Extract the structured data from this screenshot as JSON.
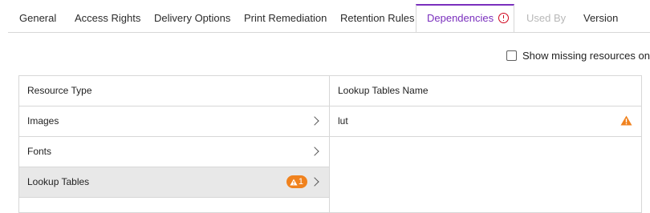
{
  "tabs": [
    {
      "label": "General",
      "state": "normal"
    },
    {
      "label": "Access Rights",
      "state": "normal"
    },
    {
      "label": "Delivery Options",
      "state": "normal"
    },
    {
      "label": "Print Remediation",
      "state": "normal"
    },
    {
      "label": "Retention Rules",
      "state": "normal"
    },
    {
      "label": "Dependencies",
      "state": "active",
      "icon": "alert-circle-icon"
    },
    {
      "label": "Used By",
      "state": "disabled"
    },
    {
      "label": "Version",
      "state": "normal"
    }
  ],
  "filter": {
    "label": "Show missing resources only",
    "checked": false
  },
  "left_panel": {
    "header": "Resource Type",
    "rows": [
      {
        "label": "Images",
        "selected": false,
        "badge": null
      },
      {
        "label": "Fonts",
        "selected": false,
        "badge": null
      },
      {
        "label": "Lookup Tables",
        "selected": true,
        "badge": "1"
      }
    ]
  },
  "right_panel": {
    "header": "Lookup Tables Name",
    "rows": [
      {
        "label": "lut",
        "icon": "warning-triangle-icon"
      }
    ]
  },
  "colors": {
    "accent": "#7a2fbd",
    "error": "#d0021b",
    "warning": "#f0821e",
    "selected_row": "#e8e8e8",
    "border": "#d7d7d7"
  }
}
